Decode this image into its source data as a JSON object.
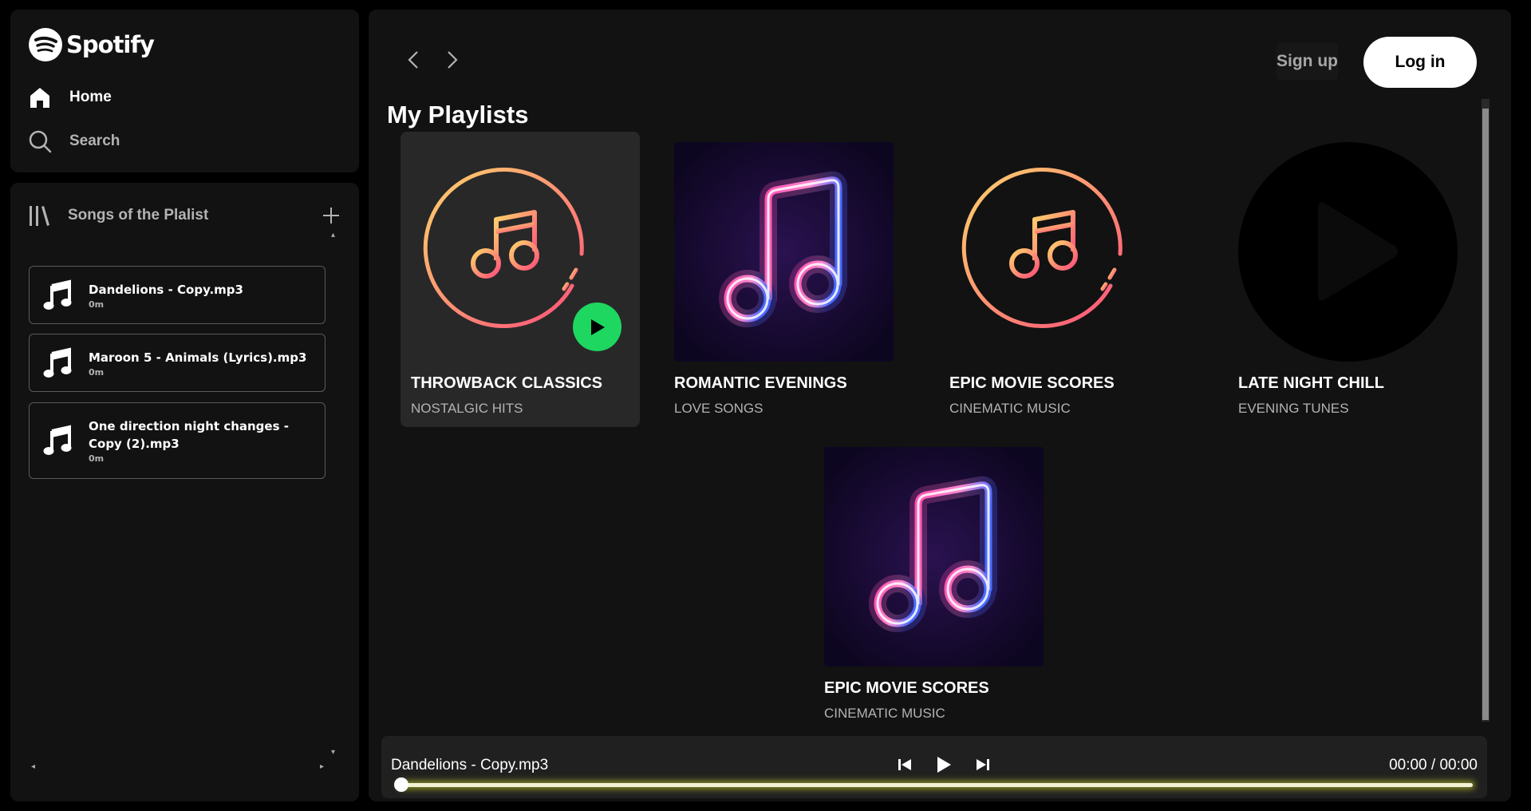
{
  "app": {
    "brand": "Spotify"
  },
  "nav": {
    "home": "Home",
    "search": "Search"
  },
  "library": {
    "title": "Songs of the Plalist",
    "add_icon": "plus-icon",
    "songs": [
      {
        "name": "Dandelions - Copy.mp3",
        "duration": "0m"
      },
      {
        "name": "Maroon 5 - Animals (Lyrics).mp3",
        "duration": "0m"
      },
      {
        "name": "One direction night changes - Copy (2).mp3",
        "duration": "0m"
      }
    ]
  },
  "header": {
    "signup": "Sign up",
    "login": "Log in"
  },
  "main": {
    "section_title": "My Playlists",
    "playlists": [
      {
        "title": "THROWBACK CLASSICS",
        "subtitle": "NOSTALGIC HITS",
        "art": "gradient-ring-note"
      },
      {
        "title": "ROMANTIC EVENINGS",
        "subtitle": "LOVE SONGS",
        "art": "neon-note"
      },
      {
        "title": "EPIC MOVIE SCORES",
        "subtitle": "CINEMATIC MUSIC",
        "art": "gradient-ring-note"
      },
      {
        "title": "LATE NIGHT CHILL",
        "subtitle": "EVENING TUNES",
        "art": "black-play-circle"
      },
      {
        "title": "EPIC MOVIE SCORES",
        "subtitle": "CINEMATIC MUSIC",
        "art": "neon-note"
      }
    ]
  },
  "player": {
    "now_playing": "Dandelions - Copy.mp3",
    "time": "00:00 / 00:00",
    "progress": 0
  },
  "colors": {
    "accent": "#1ed760",
    "background": "#121212",
    "page": "#000000"
  }
}
